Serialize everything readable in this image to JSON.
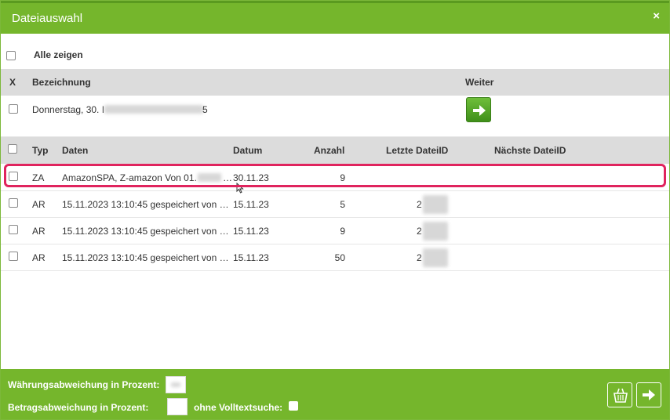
{
  "dialog": {
    "title": "Dateiauswahl",
    "close_symbol": "×"
  },
  "show_all_label": "Alle zeigen",
  "group_header": {
    "x": "X",
    "bezeichnung": "Bezeichnung",
    "weiter": "Weiter"
  },
  "group_row": {
    "label": "Donnerstag, 30. I",
    "label_tail": "5"
  },
  "file_table": {
    "headers": {
      "typ": "Typ",
      "daten": "Daten",
      "datum": "Datum",
      "anzahl": "Anzahl",
      "letzte": "Letzte DateiID",
      "naechste": "Nächste DateiID"
    },
    "rows": [
      {
        "typ": "ZA",
        "daten": "AmazonSPA, Z-amazon Von 01.",
        "daten_tail": "…",
        "datum": "30.11.23",
        "anzahl": "9",
        "letzte": ""
      },
      {
        "typ": "AR",
        "daten": "15.11.2023 13:10:45 gespeichert von …",
        "daten_tail": "",
        "datum": "15.11.23",
        "anzahl": "5",
        "letzte": "2"
      },
      {
        "typ": "AR",
        "daten": "15.11.2023 13:10:45 gespeichert von …",
        "daten_tail": "",
        "datum": "15.11.23",
        "anzahl": "9",
        "letzte": "2"
      },
      {
        "typ": "AR",
        "daten": "15.11.2023 13:10:45 gespeichert von …",
        "daten_tail": "",
        "datum": "15.11.23",
        "anzahl": "50",
        "letzte": "2"
      }
    ]
  },
  "footer": {
    "waehrung_label": "Währungsabweichung in Prozent:",
    "betrag_label": "Betragsabweichung in Prozent:",
    "volltext_label": "ohne Volltextsuche:"
  },
  "icons": {
    "arrow": "arrow-right-icon",
    "basket": "basket-icon"
  }
}
